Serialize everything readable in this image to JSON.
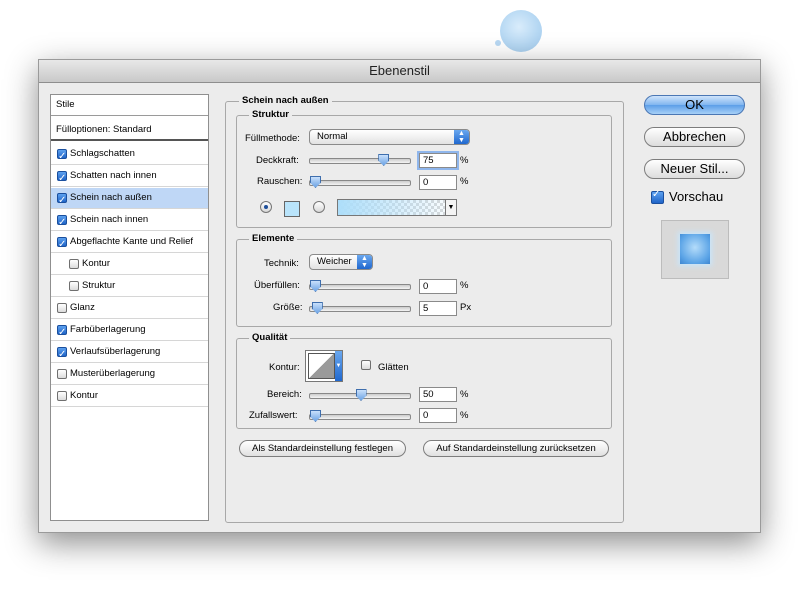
{
  "window": {
    "title": "Ebenenstil"
  },
  "sidebar": {
    "header": "Stile",
    "blend_options": "Fülloptionen: Standard",
    "items": [
      {
        "label": "Schlagschatten",
        "checked": true,
        "selected": false,
        "indent": false
      },
      {
        "label": "Schatten nach innen",
        "checked": true,
        "selected": false,
        "indent": false
      },
      {
        "label": "Schein nach außen",
        "checked": true,
        "selected": true,
        "indent": false
      },
      {
        "label": "Schein nach innen",
        "checked": true,
        "selected": false,
        "indent": false
      },
      {
        "label": "Abgeflachte Kante und Relief",
        "checked": true,
        "selected": false,
        "indent": false
      },
      {
        "label": "Kontur",
        "checked": false,
        "selected": false,
        "indent": true
      },
      {
        "label": "Struktur",
        "checked": false,
        "selected": false,
        "indent": true
      },
      {
        "label": "Glanz",
        "checked": false,
        "selected": false,
        "indent": false
      },
      {
        "label": "Farbüberlagerung",
        "checked": true,
        "selected": false,
        "indent": false
      },
      {
        "label": "Verlaufsüberlagerung",
        "checked": true,
        "selected": false,
        "indent": false
      },
      {
        "label": "Musterüberlagerung",
        "checked": false,
        "selected": false,
        "indent": false
      },
      {
        "label": "Kontur",
        "checked": false,
        "selected": false,
        "indent": false
      }
    ]
  },
  "panel": {
    "title": "Schein nach außen",
    "structure": {
      "title": "Struktur",
      "blend_mode_label": "Füllmethode:",
      "blend_mode_value": "Normal",
      "opacity_label": "Deckkraft:",
      "opacity_value": "75",
      "opacity_level": 0.75,
      "opacity_unit": "%",
      "noise_label": "Rauschen:",
      "noise_value": "0",
      "noise_level": 0,
      "noise_unit": "%",
      "color_swatch": "#b9e4fb"
    },
    "elements": {
      "title": "Elemente",
      "technique_label": "Technik:",
      "technique_value": "Weicher",
      "spread_label": "Überfüllen:",
      "spread_value": "0",
      "spread_level": 0,
      "spread_unit": "%",
      "size_label": "Größe:",
      "size_value": "5",
      "size_level": 0.02,
      "size_unit": "Px"
    },
    "quality": {
      "title": "Qualität",
      "contour_label": "Kontur:",
      "antialias_label": "Glätten",
      "antialias_checked": false,
      "range_label": "Bereich:",
      "range_value": "50",
      "range_level": 0.5,
      "range_unit": "%",
      "jitter_label": "Zufallswert:",
      "jitter_value": "0",
      "jitter_level": 0,
      "jitter_unit": "%"
    },
    "make_default": "Als Standardeinstellung festlegen",
    "reset_default": "Auf Standardeinstellung zurücksetzen"
  },
  "actions": {
    "ok": "OK",
    "cancel": "Abbrechen",
    "new_style": "Neuer Stil...",
    "preview_label": "Vorschau",
    "preview_checked": true
  },
  "colors": {
    "accent": "#3b7fd9",
    "selection": "#bfd7f6",
    "glow": "#b9e4fb"
  }
}
